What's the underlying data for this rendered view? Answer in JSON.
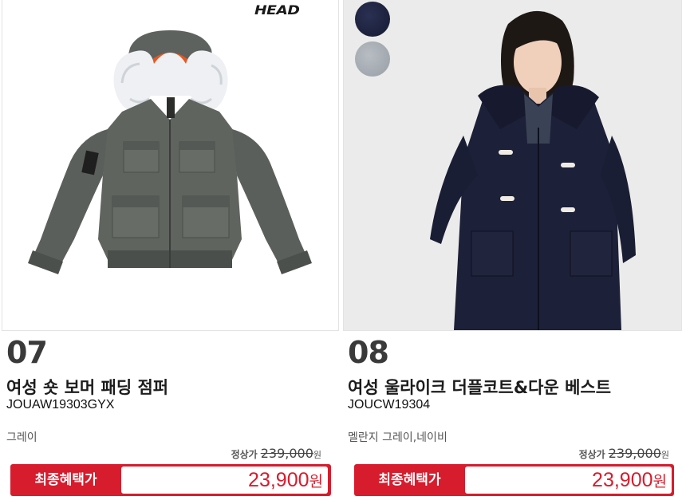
{
  "products": [
    {
      "number": "07",
      "name": "여성 숏 보머 패딩 점퍼",
      "code": "JOUAW19303GYX",
      "color": "그레이",
      "regular_label": "정상가",
      "regular_price": "239,000",
      "regular_unit": "원",
      "benefit_label": "최종혜택가",
      "benefit_price": "23,900",
      "benefit_unit": "원",
      "brand_logo": "HEAD",
      "image": "gray-bomber-jacket-with-fur-hood"
    },
    {
      "number": "08",
      "name": "여성 울라이크 더플코트&다운 베스트",
      "code": "JOUCW19304",
      "color": "멜란지 그레이,네이비",
      "regular_label": "정상가",
      "regular_price": "239,000",
      "regular_unit": "원",
      "benefit_label": "최종혜택가",
      "benefit_price": "23,900",
      "benefit_unit": "원",
      "image": "woman-in-navy-duffle-coat",
      "swatches": [
        "#1d2340",
        "#a7adb3"
      ]
    }
  ],
  "colors": {
    "accent": "#d61c2d"
  }
}
